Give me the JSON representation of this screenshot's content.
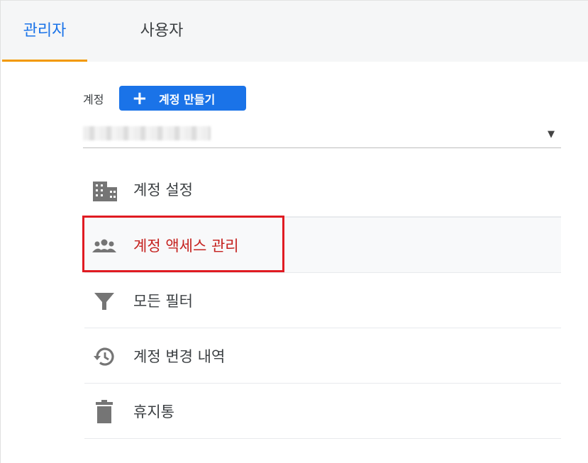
{
  "tabs": [
    {
      "label": "관리자",
      "active": true
    },
    {
      "label": "사용자",
      "active": false
    }
  ],
  "account": {
    "label": "계정",
    "create_button": "계정 만들기",
    "selected_value": ""
  },
  "menu": {
    "items": [
      {
        "label": "계정 설정",
        "icon": "building-icon"
      },
      {
        "label": "계정 액세스 관리",
        "icon": "people-icon",
        "highlighted": true
      },
      {
        "label": "모든 필터",
        "icon": "filter-icon"
      },
      {
        "label": "계정 변경 내역",
        "icon": "history-icon"
      },
      {
        "label": "휴지통",
        "icon": "trash-icon"
      }
    ]
  },
  "colors": {
    "accent": "#1a73e8",
    "tab_underline": "#f29900",
    "highlight_border": "#e01b22",
    "highlight_text": "#c5221f",
    "icon": "#757575"
  }
}
